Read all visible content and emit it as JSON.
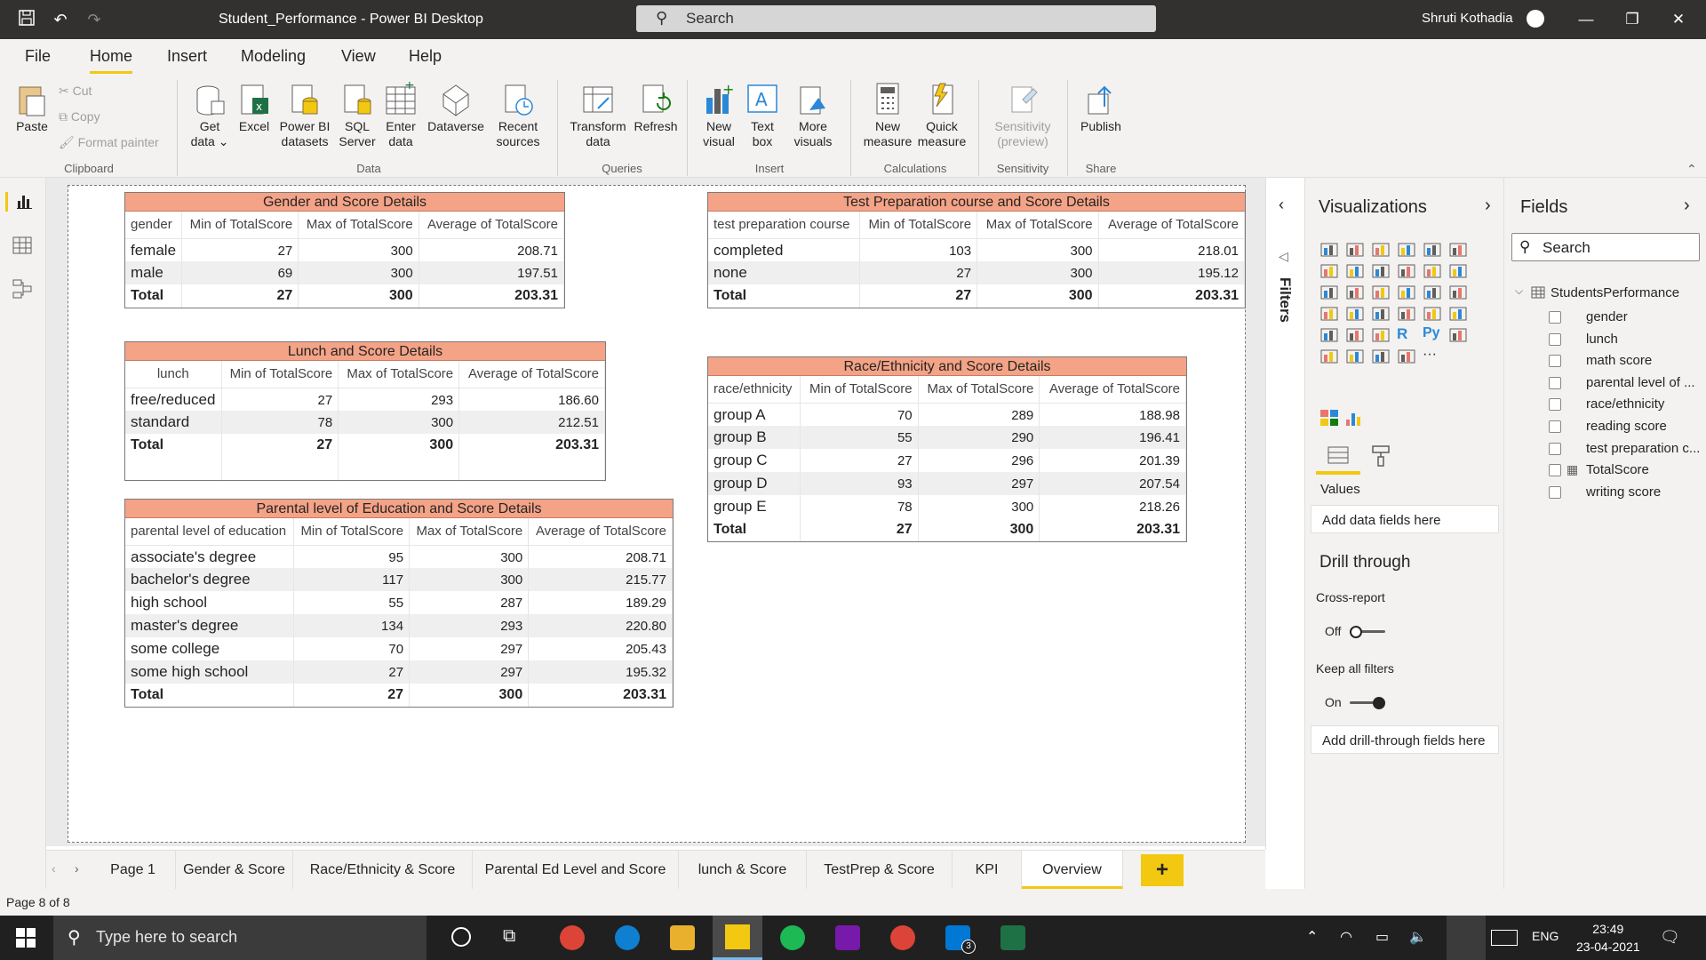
{
  "titlebar": {
    "title": "Student_Performance - Power BI Desktop",
    "search_placeholder": "Search",
    "user": "Shruti Kothadia"
  },
  "menu": [
    "File",
    "Home",
    "Insert",
    "Modeling",
    "View",
    "Help"
  ],
  "ribbon": {
    "paste": "Paste",
    "cut": "Cut",
    "copy": "Copy",
    "format_painter": "Format painter",
    "clipboard": "Clipboard",
    "get_data": "Get data",
    "excel": "Excel",
    "pbi_datasets": "Power BI datasets",
    "sql": "SQL Server",
    "enter_data": "Enter data",
    "dataverse": "Dataverse",
    "recent": "Recent sources",
    "data": "Data",
    "transform": "Transform data",
    "refresh": "Refresh",
    "queries": "Queries",
    "new_visual": "New visual",
    "text_box": "Text box",
    "more_visuals": "More visuals",
    "insert": "Insert",
    "new_measure": "New measure",
    "quick_measure": "Quick measure",
    "calculations": "Calculations",
    "sensitivity_btn": "Sensitivity (preview)",
    "sensitivity": "Sensitivity",
    "publish": "Publish",
    "share": "Share"
  },
  "tables": {
    "gender": {
      "title": "Gender and Score Details",
      "headers": [
        "gender",
        "Min of TotalScore",
        "Max of TotalScore",
        "Average of TotalScore"
      ],
      "rows": [
        [
          "female",
          "27",
          "300",
          "208.71"
        ],
        [
          "male",
          "69",
          "300",
          "197.51"
        ]
      ],
      "total": [
        "Total",
        "27",
        "300",
        "203.31"
      ]
    },
    "testprep": {
      "title": "Test Preparation course and Score Details",
      "headers": [
        "test preparation course",
        "Min of TotalScore",
        "Max of TotalScore",
        "Average of TotalScore"
      ],
      "rows": [
        [
          "completed",
          "103",
          "300",
          "218.01"
        ],
        [
          "none",
          "27",
          "300",
          "195.12"
        ]
      ],
      "total": [
        "Total",
        "27",
        "300",
        "203.31"
      ]
    },
    "lunch": {
      "title": "Lunch and Score Details",
      "headers": [
        "lunch",
        "Min of TotalScore",
        "Max of TotalScore",
        "Average of TotalScore"
      ],
      "rows": [
        [
          "free/reduced",
          "27",
          "293",
          "186.60"
        ],
        [
          "standard",
          "78",
          "300",
          "212.51"
        ]
      ],
      "total": [
        "Total",
        "27",
        "300",
        "203.31"
      ]
    },
    "race": {
      "title": "Race/Ethnicity and Score Details",
      "headers": [
        "race/ethnicity",
        "Min of TotalScore",
        "Max of TotalScore",
        "Average of TotalScore"
      ],
      "rows": [
        [
          "group A",
          "70",
          "289",
          "188.98"
        ],
        [
          "group B",
          "55",
          "290",
          "196.41"
        ],
        [
          "group C",
          "27",
          "296",
          "201.39"
        ],
        [
          "group D",
          "93",
          "297",
          "207.54"
        ],
        [
          "group E",
          "78",
          "300",
          "218.26"
        ]
      ],
      "total": [
        "Total",
        "27",
        "300",
        "203.31"
      ]
    },
    "parental": {
      "title": "Parental level of Education and Score Details",
      "headers": [
        "parental level of education",
        "Min of TotalScore",
        "Max of TotalScore",
        "Average of TotalScore"
      ],
      "rows": [
        [
          "associate's degree",
          "95",
          "300",
          "208.71"
        ],
        [
          "bachelor's degree",
          "117",
          "300",
          "215.77"
        ],
        [
          "high school",
          "55",
          "287",
          "189.29"
        ],
        [
          "master's degree",
          "134",
          "293",
          "220.80"
        ],
        [
          "some college",
          "70",
          "297",
          "205.43"
        ],
        [
          "some high school",
          "27",
          "297",
          "195.32"
        ]
      ],
      "total": [
        "Total",
        "27",
        "300",
        "203.31"
      ]
    }
  },
  "filters": {
    "label": "Filters"
  },
  "visualizations": {
    "title": "Visualizations",
    "values_label": "Values",
    "add_data": "Add data fields here",
    "drill_through": "Drill through",
    "cross_report": "Cross-report",
    "cross_state": "Off",
    "keep_filters": "Keep all filters",
    "keep_state": "On",
    "add_drill": "Add drill-through fields here"
  },
  "fields": {
    "title": "Fields",
    "search_placeholder": "Search",
    "table": "StudentsPerformance",
    "items": [
      "gender",
      "lunch",
      "math score",
      "parental level of ...",
      "race/ethnicity",
      "reading score",
      "test preparation c...",
      "TotalScore",
      "writing score"
    ]
  },
  "tabs": [
    "Page 1",
    "Gender & Score",
    "Race/Ethnicity & Score",
    "Parental Ed Level and Score",
    "lunch & Score",
    "TestPrep & Score",
    "KPI",
    "Overview"
  ],
  "status": "Page 8 of 8",
  "taskbar": {
    "search_placeholder": "Type here to search",
    "lang": "ENG",
    "time": "23:49",
    "date": "23-04-2021",
    "mail_badge": "3"
  }
}
